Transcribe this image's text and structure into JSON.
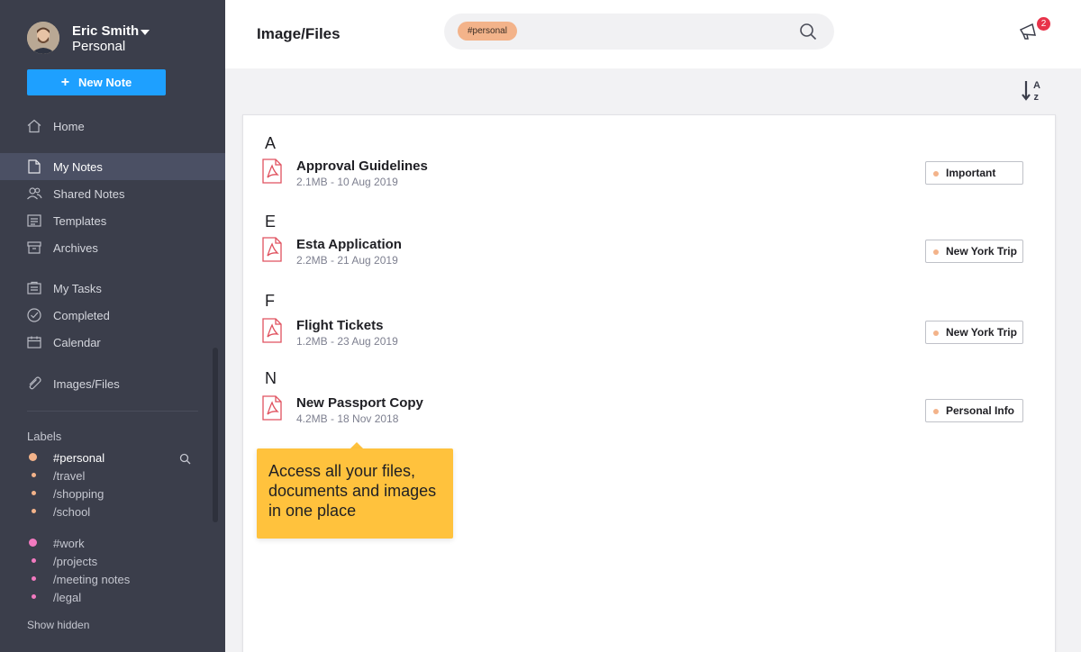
{
  "profile": {
    "name": "Eric Smith",
    "workspace": "Personal"
  },
  "new_note": {
    "label": "New Note"
  },
  "nav": [
    {
      "label": "Home",
      "icon": "home-icon"
    },
    {
      "label": "My Notes",
      "icon": "notes-icon",
      "active": true
    },
    {
      "label": "Shared Notes",
      "icon": "shared-users-icon"
    },
    {
      "label": "Templates",
      "icon": "templates-icon"
    },
    {
      "label": "Archives",
      "icon": "archive-icon"
    },
    {
      "label": "My Tasks",
      "icon": "tasks-icon"
    },
    {
      "label": "Completed",
      "icon": "check-circle-icon"
    },
    {
      "label": "Calendar",
      "icon": "calendar-icon"
    },
    {
      "label": "Images/Files",
      "icon": "paperclip-icon"
    }
  ],
  "labels": {
    "title": "Labels",
    "groups": [
      {
        "name": "#personal",
        "color": "#f3b38a",
        "children": [
          "/travel",
          "/shopping",
          "/school"
        ]
      },
      {
        "name": "#work",
        "color": "#f27ac0",
        "children": [
          "/projects",
          "/meeting notes",
          "/legal"
        ]
      }
    ],
    "show_hidden": "Show hidden"
  },
  "header": {
    "title": "Image/Files",
    "search_chip": "#personal",
    "notification_count": "2"
  },
  "files": [
    {
      "letter": "A",
      "name": "Approval Guidelines",
      "meta": "2.1MB - 10 Aug 2019",
      "tag": "Important"
    },
    {
      "letter": "E",
      "name": "Esta Application",
      "meta": "2.2MB - 21 Aug 2019",
      "tag": "New York Trip"
    },
    {
      "letter": "F",
      "name": "Flight Tickets",
      "meta": "1.2MB - 23 Aug 2019",
      "tag": "New York Trip"
    },
    {
      "letter": "N",
      "name": "New Passport Copy",
      "meta": "4.2MB - 18 Nov 2018",
      "tag": "Personal Info"
    }
  ],
  "tooltip": {
    "text": "Access all your files, documents and images in one place"
  },
  "colors": {
    "sidebar": "#3b3e4b",
    "accent": "#1ea0ff",
    "tag_dot": "#f3b38a",
    "tooltip": "#ffc23d",
    "badge": "#e8334a",
    "pdf_icon": "#e0525f"
  }
}
